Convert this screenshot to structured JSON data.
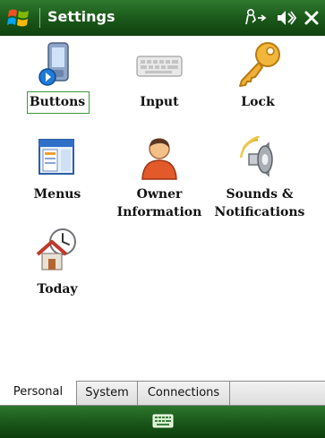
{
  "window": {
    "title": "Settings"
  },
  "titlebar_icons": [
    "windows-start-icon",
    "connectivity-icon",
    "volume-icon",
    "close-icon"
  ],
  "items": [
    {
      "label": "Buttons",
      "icon": "buttons-icon",
      "selected": true
    },
    {
      "label": "Input",
      "icon": "keyboard-icon"
    },
    {
      "label": "Lock",
      "icon": "key-icon"
    },
    {
      "label": "Menus",
      "icon": "menus-icon"
    },
    {
      "label_line1": "Owner",
      "label_line2": "Information",
      "icon": "person-icon"
    },
    {
      "label_line1": "Sounds &",
      "label_line2": "Notifications",
      "icon": "speaker-icon"
    },
    {
      "label": "Today",
      "icon": "home-clock-icon"
    }
  ],
  "tabs": [
    {
      "label": "Personal",
      "active": true
    },
    {
      "label": "System",
      "active": false
    },
    {
      "label": "Connections",
      "active": false
    }
  ],
  "softbar": {
    "center_icon": "keyboard-icon"
  },
  "colors": {
    "titlebar": "#1d5c1d",
    "selection_border": "#3c9a3c"
  }
}
